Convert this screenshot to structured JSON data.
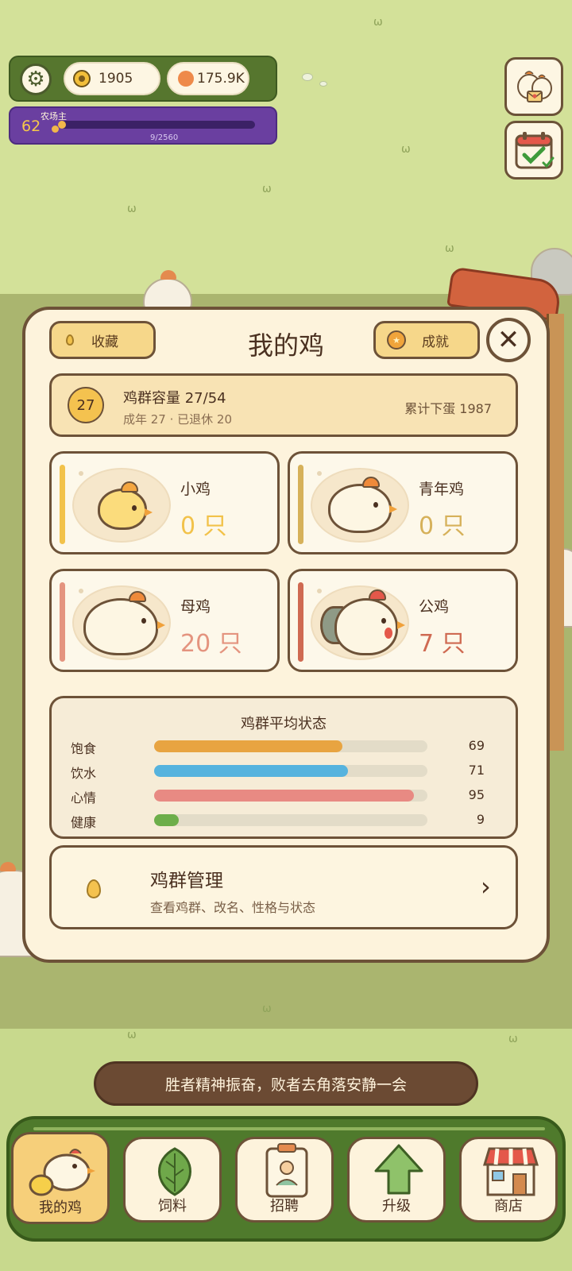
{
  "hud": {
    "gold": "1905",
    "gems": "175.9K",
    "farmer_title": "农场主",
    "level": "62",
    "xp_text": "9/2560",
    "xp_progress": 0.04
  },
  "modal": {
    "title": "我的鸡",
    "collect_label": "收藏",
    "achievement_label": "成就",
    "close_symbol": "✕",
    "capacity": {
      "badge": "27",
      "title": "鸡群容量 27/54",
      "subtitle": "成年 27 · 已退休 20",
      "eggs": "累计下蛋 1987"
    },
    "categories": [
      {
        "name": "小鸡",
        "count": "0 只",
        "color": "#f2c24a"
      },
      {
        "name": "青年鸡",
        "count": "0 只",
        "color": "#d6b15a"
      },
      {
        "name": "母鸡",
        "count": "20 只",
        "color": "#e4947f"
      },
      {
        "name": "公鸡",
        "count": "7 只",
        "color": "#cf6a52"
      }
    ],
    "stats": {
      "title": "鸡群平均状态",
      "items": [
        {
          "label": "饱食",
          "value": 69,
          "color": "#e8a441"
        },
        {
          "label": "饮水",
          "value": 71,
          "color": "#56b3de"
        },
        {
          "label": "心情",
          "value": 95,
          "color": "#e88a83"
        },
        {
          "label": "健康",
          "value": 9,
          "color": "#6dae4a"
        }
      ]
    },
    "manage": {
      "title": "鸡群管理",
      "subtitle": "查看鸡群、改名、性格与状态",
      "chevron": "›"
    }
  },
  "toast": "胜者精神振奋，败者去角落安静一会",
  "nav": [
    {
      "label": "我的鸡",
      "icon": "chicken-icon",
      "active": true
    },
    {
      "label": "饲料",
      "icon": "leaf-icon",
      "active": false
    },
    {
      "label": "招聘",
      "icon": "badge-icon",
      "active": false
    },
    {
      "label": "升级",
      "icon": "arrow-up-icon",
      "active": false
    },
    {
      "label": "商店",
      "icon": "shop-icon",
      "active": false
    }
  ]
}
